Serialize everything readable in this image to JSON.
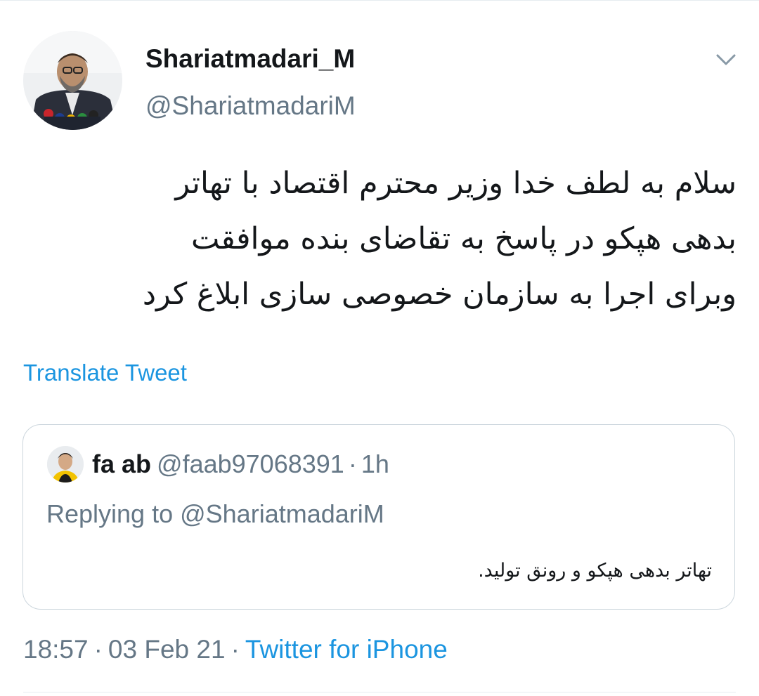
{
  "colors": {
    "link": "#1b95e0",
    "secondary_text": "#657786",
    "primary_text": "#14171a",
    "border": "#ccd6dd"
  },
  "author": {
    "display_name": "Shariatmadari_M",
    "handle": "@ShariatmadariM",
    "avatar_icon": "profile-photo"
  },
  "menu": {
    "icon": "chevron-down-icon"
  },
  "tweet": {
    "lines": [
      "سلام به لطف خدا وزیر محترم اقتصاد با تهاتر",
      "بدهی هپکو در پاسخ به تقاضای بنده موافقت",
      "وبرای اجرا به سازمان خصوصی سازی ابلاغ کرد"
    ],
    "translate_label": "Translate Tweet"
  },
  "quoted_tweet": {
    "display_name": "fa ab",
    "handle": "@faab97068391",
    "separator": "·",
    "time": "1h",
    "replying_to": "Replying to @ShariatmadariM",
    "text": "تهاتر بدهی هپکو و رونق تولید."
  },
  "meta": {
    "time": "18:57",
    "separator": "·",
    "date": "03 Feb 21",
    "source": "Twitter for iPhone"
  }
}
